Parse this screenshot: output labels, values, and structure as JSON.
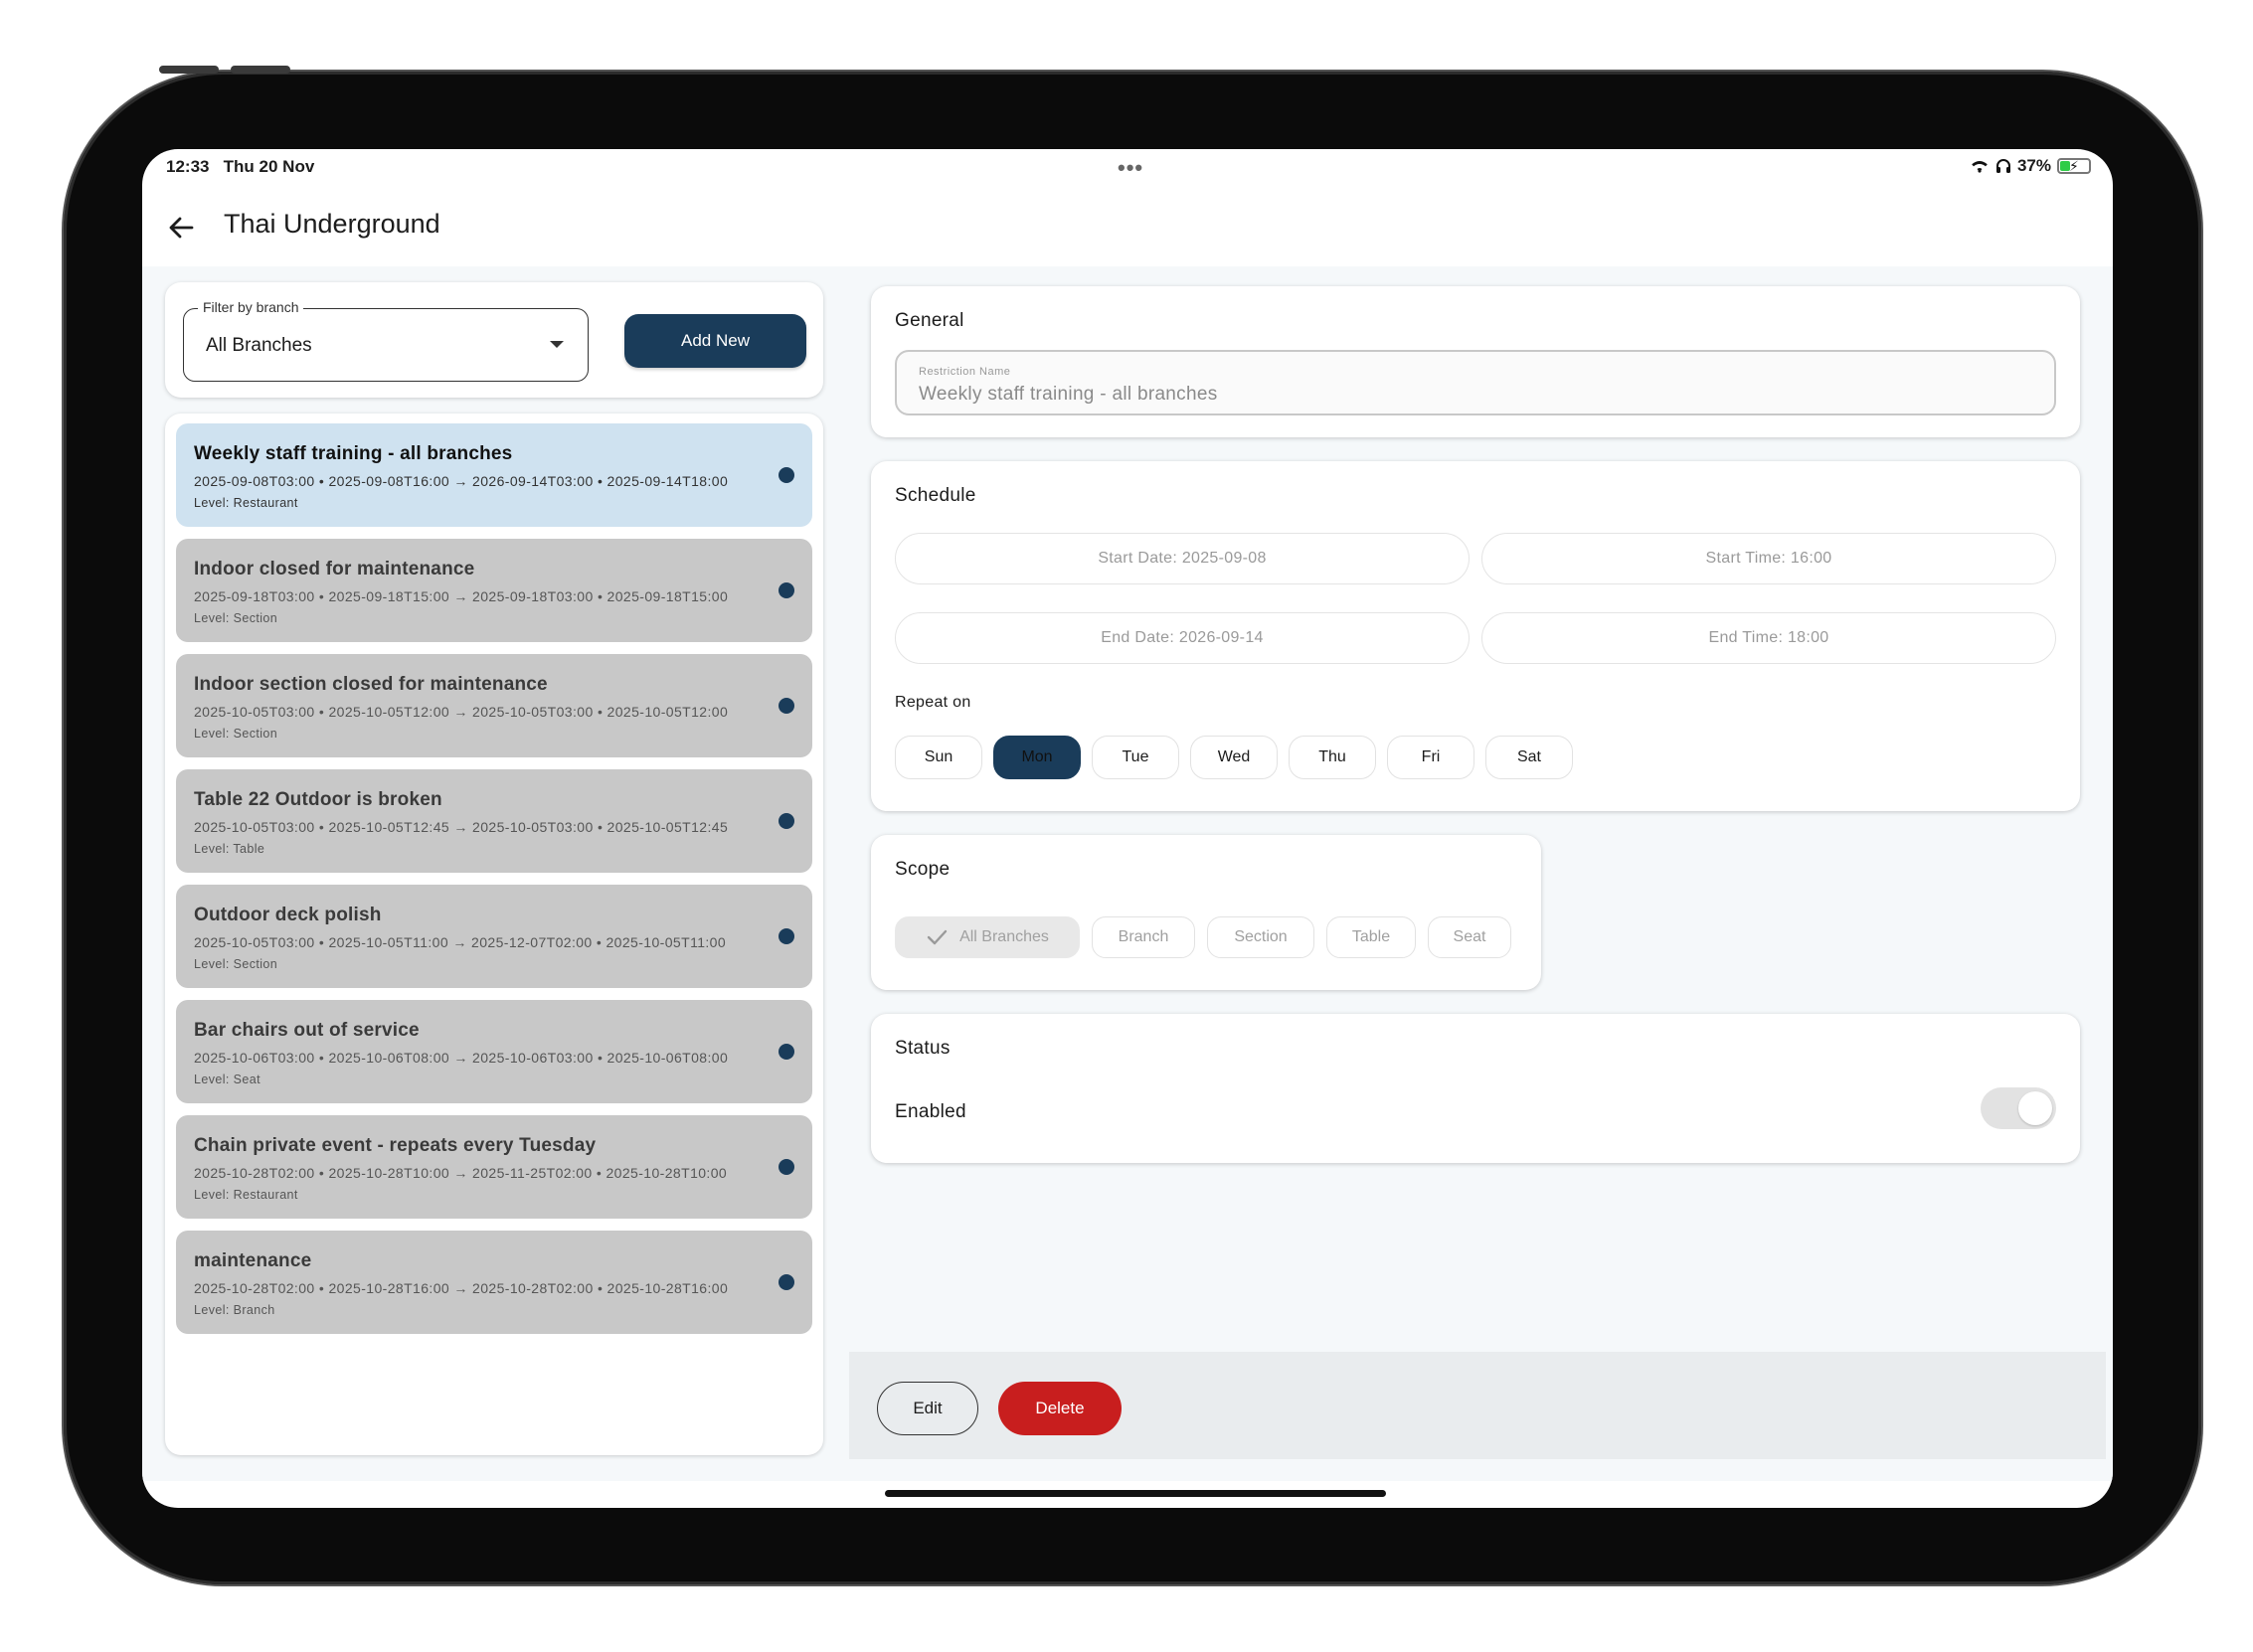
{
  "statusbar": {
    "time": "12:33",
    "date": "Thu 20 Nov",
    "dots": "•••",
    "battery_pct": "37%",
    "battery_level": 0.37,
    "icons": [
      "wifi-icon",
      "headphones-icon",
      "battery-icon"
    ]
  },
  "appbar": {
    "title": "Thai Underground",
    "back_icon": "arrow-left-icon"
  },
  "filter": {
    "label": "Filter by branch",
    "value": "All Branches",
    "add_new": "Add New"
  },
  "restrictions": [
    {
      "title": "Weekly staff training - all branches",
      "dates": "2025-09-08T03:00 • 2025-09-08T16:00  →  2026-09-14T03:00 • 2025-09-14T18:00",
      "level": "Level: Restaurant",
      "selected": true
    },
    {
      "title": "Indoor closed for maintenance",
      "dates": "2025-09-18T03:00 • 2025-09-18T15:00  →  2025-09-18T03:00 • 2025-09-18T15:00",
      "level": "Level: Section",
      "selected": false
    },
    {
      "title": "Indoor section closed for maintenance",
      "dates": "2025-10-05T03:00 • 2025-10-05T12:00  →  2025-10-05T03:00 • 2025-10-05T12:00",
      "level": "Level: Section",
      "selected": false
    },
    {
      "title": "Table 22 Outdoor is broken",
      "dates": "2025-10-05T03:00 • 2025-10-05T12:45  →  2025-10-05T03:00 • 2025-10-05T12:45",
      "level": "Level: Table",
      "selected": false
    },
    {
      "title": "Outdoor deck polish",
      "dates": "2025-10-05T03:00 • 2025-10-05T11:00  →  2025-12-07T02:00 • 2025-10-05T11:00",
      "level": "Level: Section",
      "selected": false
    },
    {
      "title": "Bar chairs out of service",
      "dates": "2025-10-06T03:00 • 2025-10-06T08:00  →  2025-10-06T03:00 • 2025-10-06T08:00",
      "level": "Level: Seat",
      "selected": false
    },
    {
      "title": "Chain private event - repeats every Tuesday",
      "dates": "2025-10-28T02:00 • 2025-10-28T10:00  →  2025-11-25T02:00 • 2025-10-28T10:00",
      "level": "Level: Restaurant",
      "selected": false
    },
    {
      "title": "maintenance",
      "dates": "2025-10-28T02:00 • 2025-10-28T16:00  →  2025-10-28T02:00 • 2025-10-28T16:00",
      "level": "Level: Branch",
      "selected": false
    }
  ],
  "general": {
    "title": "General",
    "name_label": "Restriction Name",
    "name_value": "Weekly staff training - all branches"
  },
  "schedule": {
    "title": "Schedule",
    "start_date": "Start Date: 2025-09-08",
    "start_time": "Start Time: 16:00",
    "end_date": "End Date: 2026-09-14",
    "end_time": "End Time: 18:00",
    "repeat_label": "Repeat on",
    "days": [
      "Sun",
      "Mon",
      "Tue",
      "Wed",
      "Thu",
      "Fri",
      "Sat"
    ],
    "active_day": "Mon"
  },
  "scope": {
    "title": "Scope",
    "options": [
      "All Branches",
      "Branch",
      "Section",
      "Table",
      "Seat"
    ],
    "selected": "All Branches"
  },
  "status": {
    "title": "Status",
    "enabled_label": "Enabled",
    "enabled": true
  },
  "actions": {
    "edit": "Edit",
    "delete": "Delete"
  },
  "colors": {
    "primary": "#1a3c5a",
    "danger": "#c81e1e",
    "selected_item": "#cfe2f0",
    "item": "#c8c8c8"
  }
}
